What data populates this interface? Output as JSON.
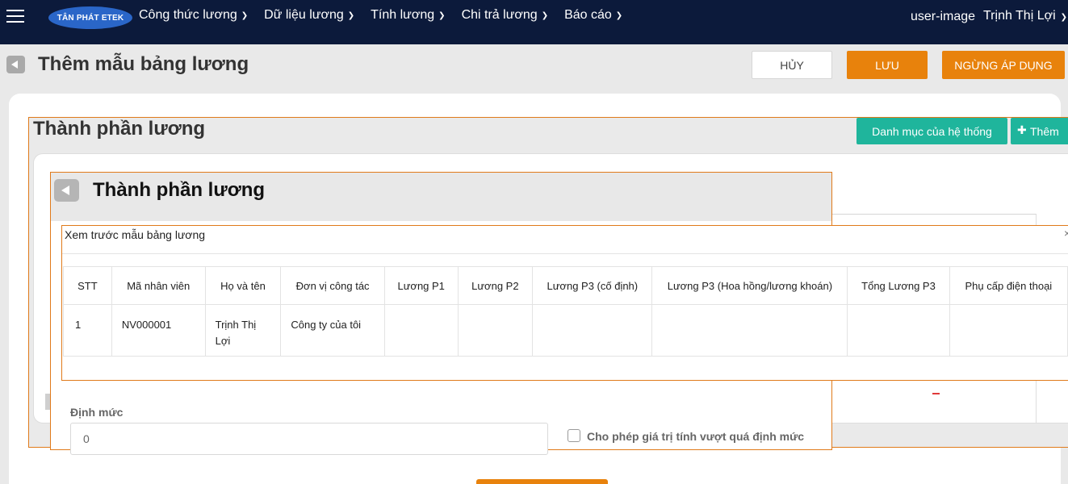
{
  "nav": {
    "logo": "TÂN PHÁT ETEK",
    "items": [
      {
        "label": "Công thức lương"
      },
      {
        "label": "Dữ liệu lương"
      },
      {
        "label": "Tính lương"
      },
      {
        "label": "Chi trả lương"
      },
      {
        "label": "Báo cáo"
      }
    ],
    "user_image": "user-image",
    "user_name": "Trịnh Thị Lợi"
  },
  "page": {
    "title": "Thêm mẫu bảng lương",
    "cancel": "HỦY",
    "save": "LƯU",
    "stop": "NGỪNG ÁP DỤNG"
  },
  "dialog1": {
    "title": "Thành phần lương",
    "system_catalog": "Danh mục của hệ thống",
    "add": "Thêm"
  },
  "dialog2": {
    "title": "Thành phần lương"
  },
  "preview": {
    "title": "Xem trước mẫu bảng lương",
    "close": "×",
    "columns": [
      "STT",
      "Mã nhân viên",
      "Họ và tên",
      "Đơn vị công tác",
      "Lương P1",
      "Lương P2",
      "Lương P3 (cố định)",
      "Lương P3 (Hoa hồng/lương khoán)",
      "Tổng Lương P3",
      "Phụ cấp điện thoại"
    ],
    "rows": [
      [
        "1",
        "NV000001",
        "Trịnh Thị Lợi",
        "Công ty của tôi",
        "",
        "",
        "",
        "",
        "",
        ""
      ]
    ]
  },
  "form": {
    "dinh_muc_label": "Định mức",
    "dinh_muc_value": "0",
    "allow_exceed_label": "Cho phép giá trị tính vượt quá định mức"
  }
}
